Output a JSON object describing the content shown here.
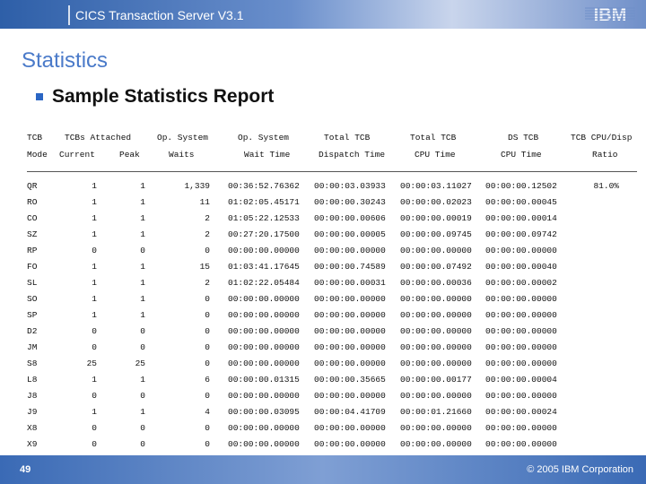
{
  "header": {
    "title": "CICS Transaction Server V3.1",
    "logo": "IBM"
  },
  "slide": {
    "title": "Statistics",
    "bullet": "Sample Statistics Report"
  },
  "table": {
    "headers_line1": [
      "TCB",
      "TCBs Attached",
      "Op. System",
      "Op. System",
      "Total TCB",
      "Total TCB",
      "DS TCB",
      "TCB CPU/Disp"
    ],
    "headers_line2": [
      "Mode",
      "Current",
      "Peak",
      "Waits",
      "Wait Time",
      "Dispatch Time",
      "CPU Time",
      "CPU Time",
      "Ratio"
    ],
    "rows": [
      [
        "QR",
        "1",
        "1",
        "1,339",
        "00:36:52.76362",
        "00:00:03.03933",
        "00:00:03.11027",
        "00:00:00.12502",
        "81.0%"
      ],
      [
        "RO",
        "1",
        "1",
        "11",
        "01:02:05.45171",
        "00:00:00.30243",
        "00:00:00.02023",
        "00:00:00.00045",
        ""
      ],
      [
        "CO",
        "1",
        "1",
        "2",
        "01:05:22.12533",
        "00:00:00.00606",
        "00:00:00.00019",
        "00:00:00.00014",
        ""
      ],
      [
        "SZ",
        "1",
        "1",
        "2",
        "00:27:20.17500",
        "00:00:00.00005",
        "00:00:00.09745",
        "00:00:00.09742",
        ""
      ],
      [
        "RP",
        "0",
        "0",
        "0",
        "00:00:00.00000",
        "00:00:00.00000",
        "00:00:00.00000",
        "00:00:00.00000",
        ""
      ],
      [
        "FO",
        "1",
        "1",
        "15",
        "01:03:41.17645",
        "00:00:00.74589",
        "00:00:00.07492",
        "00:00:00.00040",
        ""
      ],
      [
        "SL",
        "1",
        "1",
        "2",
        "01:02:22.05484",
        "00:00:00.00031",
        "00:00:00.00036",
        "00:00:00.00002",
        ""
      ],
      [
        "SO",
        "1",
        "1",
        "0",
        "00:00:00.00000",
        "00:00:00.00000",
        "00:00:00.00000",
        "00:00:00.00000",
        ""
      ],
      [
        "SP",
        "1",
        "1",
        "0",
        "00:00:00.00000",
        "00:00:00.00000",
        "00:00:00.00000",
        "00:00:00.00000",
        ""
      ],
      [
        "D2",
        "0",
        "0",
        "0",
        "00:00:00.00000",
        "00:00:00.00000",
        "00:00:00.00000",
        "00:00:00.00000",
        ""
      ],
      [
        "JM",
        "0",
        "0",
        "0",
        "00:00:00.00000",
        "00:00:00.00000",
        "00:00:00.00000",
        "00:00:00.00000",
        ""
      ],
      [
        "S8",
        "25",
        "25",
        "0",
        "00:00:00.00000",
        "00:00:00.00000",
        "00:00:00.00000",
        "00:00:00.00000",
        ""
      ],
      [
        "L8",
        "1",
        "1",
        "6",
        "00:00:00.01315",
        "00:00:00.35665",
        "00:00:00.00177",
        "00:00:00.00004",
        ""
      ],
      [
        "J8",
        "0",
        "0",
        "0",
        "00:00:00.00000",
        "00:00:00.00000",
        "00:00:00.00000",
        "00:00:00.00000",
        ""
      ],
      [
        "J9",
        "1",
        "1",
        "4",
        "00:00:00.03095",
        "00:00:04.41709",
        "00:00:01.21660",
        "00:00:00.00024",
        ""
      ],
      [
        "X8",
        "0",
        "0",
        "0",
        "00:00:00.00000",
        "00:00:00.00000",
        "00:00:00.00000",
        "00:00:00.00000",
        ""
      ],
      [
        "X9",
        "0",
        "0",
        "0",
        "00:00:00.00000",
        "00:00:00.00000",
        "00:00:00.00000",
        "00:00:00.00000",
        ""
      ]
    ]
  },
  "footer": {
    "page_number": "49",
    "copyright": "© 2005 IBM Corporation"
  }
}
